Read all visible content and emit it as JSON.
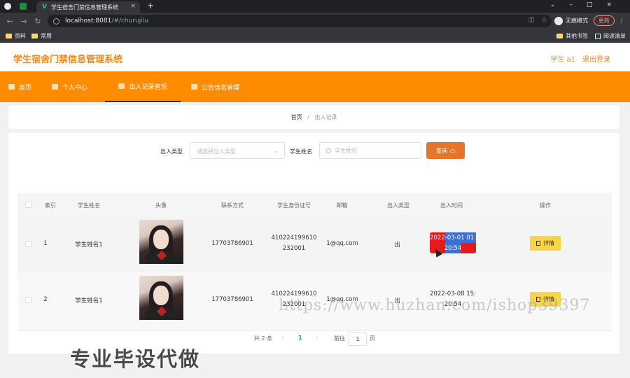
{
  "browser": {
    "tab_title": "学生宿舍门禁信息管理系统",
    "url_host": "localhost:8081",
    "url_path": "/#/churujilu",
    "incognito_label": "无痕模式",
    "update_label": "更新",
    "bookmarks": [
      "资料",
      "常用"
    ],
    "bookmarks_right": [
      "其他书签",
      "阅读清单"
    ]
  },
  "header": {
    "title": "学生宿舍门禁信息管理系统",
    "user": "学生 a1",
    "logout": "退出登录"
  },
  "nav": {
    "items": [
      "首页",
      "个人中心",
      "出入记录管理",
      "公告信息管理"
    ],
    "active": "出入记录管理"
  },
  "breadcrumb": {
    "home": "首页",
    "sep": "/",
    "current": "出入记录"
  },
  "search": {
    "type_label": "出入类型",
    "type_placeholder": "请选择出入类型",
    "name_label": "学生姓名",
    "name_placeholder": "学生姓名",
    "query_button": "查询"
  },
  "table": {
    "headers": [
      "索引",
      "学生姓名",
      "头像",
      "联系方式",
      "学生身份证号",
      "邮箱",
      "出入类型",
      "出入时间",
      "操作"
    ],
    "rows": [
      {
        "index": "1",
        "name": "学生姓名1",
        "phone": "17703786901",
        "id_line1": "410224199610",
        "id_line2": "232001",
        "email": "1@qq.com",
        "type": "出",
        "time_line1": "2022-03-01 01:",
        "time_line2": "20:54",
        "action": "详情"
      },
      {
        "index": "2",
        "name": "学生姓名1",
        "phone": "17703786901",
        "id_line1": "410224199610",
        "id_line2": "232001",
        "email": "1@qq.com",
        "type": "出",
        "time_line1": "2022-03-08 15:",
        "time_line2": "20:54",
        "action": "详情"
      }
    ]
  },
  "pagination": {
    "total": "共 2 条",
    "prev": "‹",
    "current": "1",
    "next": "›",
    "goto": "前往",
    "page_value": "1",
    "page_unit": "页"
  },
  "overlay": {
    "watermark": "https://www.huzhan.com/ishop39397",
    "promo": "专业毕设代做"
  },
  "colors": {
    "accent": "#ff8c00",
    "title": "#f28a1a",
    "query": "#e5752a",
    "detail": "#f7d545"
  }
}
